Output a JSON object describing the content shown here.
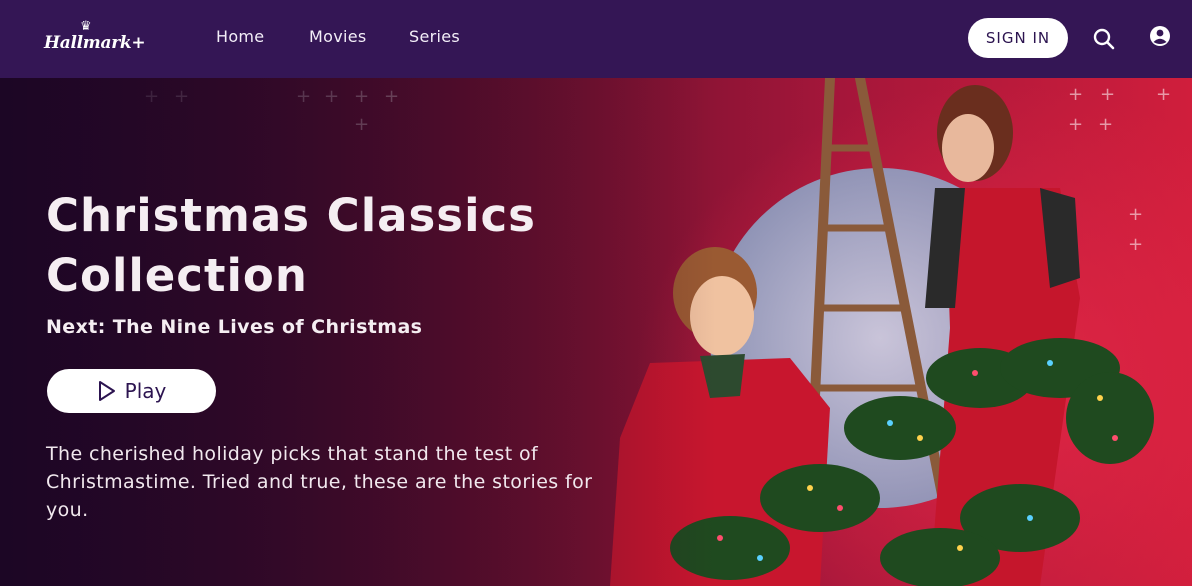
{
  "brand": {
    "logo_text": "Hallmark+"
  },
  "nav": {
    "links": [
      "Home",
      "Movies",
      "Series"
    ],
    "sign_in_label": "SIGN IN"
  },
  "icons": {
    "search": "search-icon",
    "profile": "user-circle-icon",
    "play": "play-triangle-icon"
  },
  "hero": {
    "title": "Christmas Classics Collection",
    "next": "Next: The Nine Lives of Christmas",
    "play_label": "Play",
    "description": "The cherished holiday picks that stand the test of Christmastime. Tried and true, these are the stories for you."
  },
  "colors": {
    "nav_bg": "#341655",
    "button_bg": "#ffffff",
    "button_text": "#2c1450",
    "hero_red": "#d01e3c"
  }
}
